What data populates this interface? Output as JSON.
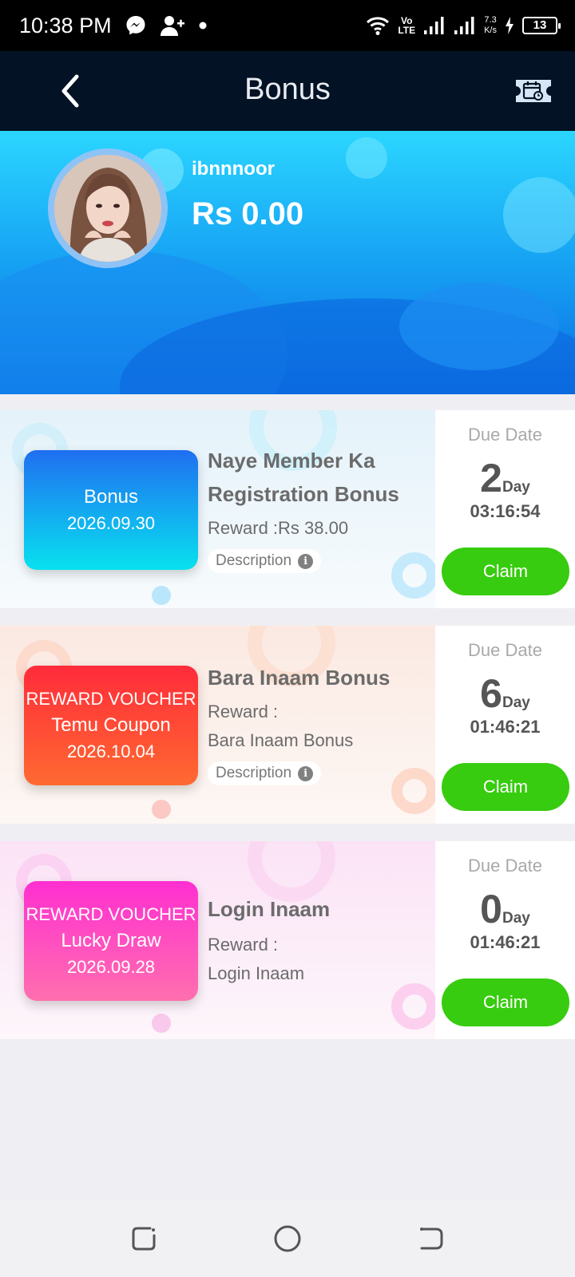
{
  "status_bar": {
    "time": "10:38 PM",
    "icons": [
      "messenger-icon",
      "add-user-icon",
      "dot-icon",
      "wifi-icon",
      "volte-icon",
      "signal-icon",
      "signal-icon",
      "charging-icon"
    ],
    "volte_line1": "Vo",
    "volte_line2": "LTE",
    "speed_value": "7.3",
    "speed_unit": "K/s",
    "battery": "13"
  },
  "header": {
    "title": "Bonus",
    "back_icon": "chevron-left-icon",
    "right_icon": "voucher-calendar-icon"
  },
  "profile": {
    "username": "ibnnnoor",
    "balance": "Rs 0.00"
  },
  "cards": [
    {
      "ticket_line1": "Bonus",
      "ticket_line2": "2026.09.30",
      "ticket_colors": [
        "#1f6ff0",
        "#08e1ef"
      ],
      "title": "Naye Member Ka Registration Bonus",
      "reward_line1": "Reward :Rs 38.00",
      "reward_line2": "",
      "description_label": "Description",
      "due_label": "Due Date",
      "days": "2",
      "days_unit": "Day",
      "countdown": "03:16:54",
      "claim_label": "Claim"
    },
    {
      "ticket_line1": "REWARD VOUCHER",
      "ticket_line2": "Temu Coupon",
      "ticket_line3": "2026.10.04",
      "ticket_colors": [
        "#ff2b3a",
        "#ff6a31"
      ],
      "title": "Bara Inaam Bonus",
      "reward_line1": "Reward :",
      "reward_line2": "Bara Inaam Bonus",
      "description_label": "Description",
      "due_label": "Due Date",
      "days": "6",
      "days_unit": "Day",
      "countdown": "01:46:21",
      "claim_label": "Claim"
    },
    {
      "ticket_line1": "REWARD VOUCHER",
      "ticket_line2": "Lucky Draw",
      "ticket_line3": "2026.09.28",
      "ticket_colors": [
        "#ff2fd1",
        "#ff6fae"
      ],
      "title": "Login Inaam",
      "reward_line1": "Reward :",
      "reward_line2": "Login Inaam",
      "due_label": "Due Date",
      "days": "0",
      "days_unit": "Day",
      "countdown": "01:46:21",
      "claim_label": "Claim"
    }
  ],
  "colors": {
    "claim_green": "#37cc0f",
    "header_bg": "#031224",
    "banner_blue": "#18a7f5"
  },
  "nav": {
    "icons": [
      "recent-apps-icon",
      "home-icon",
      "back-icon"
    ]
  }
}
